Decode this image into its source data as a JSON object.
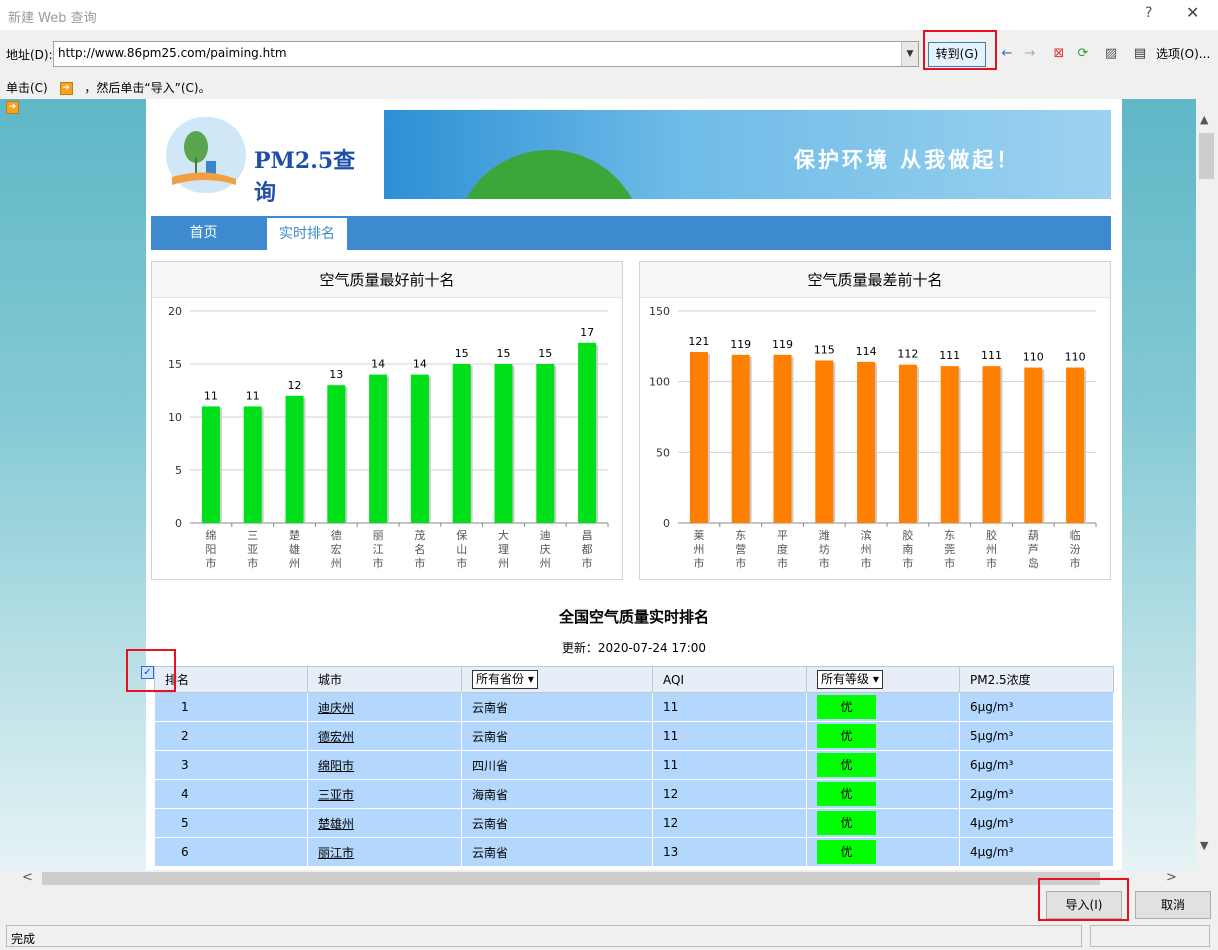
{
  "dialog": {
    "title": "新建 Web 查询",
    "help": "?",
    "close": "✕"
  },
  "address": {
    "label": "地址(D):",
    "url": "http://www.86pm25.com/paiming.htm",
    "go_label": "转到(G)",
    "options_label": "选项(O)..."
  },
  "instruction": {
    "prefix": "单击(C)",
    "suffix": "，然后单击“导入”(C)。"
  },
  "site": {
    "logo_text": "PM2.5查询",
    "banner_text": "保护环境 从我做起！",
    "nav": [
      "首页",
      "实时排名"
    ]
  },
  "best_chart": {
    "title": "空气质量最好前十名"
  },
  "worst_chart": {
    "title": "空气质量最差前十名"
  },
  "chart_data": [
    {
      "type": "bar",
      "title": "空气质量最好前十名",
      "categories": [
        "绵阳市",
        "三亚市",
        "楚雄州",
        "德宏州",
        "丽江市",
        "茂名市",
        "保山市",
        "大理州",
        "迪庆州",
        "昌都市"
      ],
      "values": [
        11,
        11,
        12,
        13,
        14,
        14,
        15,
        15,
        15,
        17
      ],
      "ylim": [
        0,
        20
      ],
      "yticks": [
        0,
        5,
        10,
        15,
        20
      ],
      "color": "#00e01a",
      "grid": true
    },
    {
      "type": "bar",
      "title": "空气质量最差前十名",
      "categories": [
        "莱州市",
        "东营市",
        "平度市",
        "潍坊市",
        "滨州市",
        "胶南市",
        "东莞市",
        "胶州市",
        "葫芦岛.",
        "临汾市"
      ],
      "values": [
        121,
        119,
        119,
        115,
        114,
        112,
        111,
        111,
        110,
        110
      ],
      "ylim": [
        0,
        150
      ],
      "yticks": [
        0,
        50,
        100,
        150
      ],
      "color": "#ff8000",
      "grid": true
    }
  ],
  "ranking": {
    "title": "全国空气质量实时排名",
    "updated": "更新：2020-07-24 17:00",
    "headers": {
      "rank": "排名",
      "city": "城市",
      "province_select": "所有省份",
      "aqi": "AQI",
      "grade_select": "所有等级",
      "pm25": "PM2.5浓度"
    },
    "rows": [
      {
        "rank": "1",
        "city": "迪庆州",
        "province": "云南省",
        "aqi": "11",
        "grade": "优",
        "pm25": "6μg/m³"
      },
      {
        "rank": "2",
        "city": "德宏州",
        "province": "云南省",
        "aqi": "11",
        "grade": "优",
        "pm25": "5μg/m³"
      },
      {
        "rank": "3",
        "city": "绵阳市",
        "province": "四川省",
        "aqi": "11",
        "grade": "优",
        "pm25": "6μg/m³"
      },
      {
        "rank": "4",
        "city": "三亚市",
        "province": "海南省",
        "aqi": "12",
        "grade": "优",
        "pm25": "2μg/m³"
      },
      {
        "rank": "5",
        "city": "楚雄州",
        "province": "云南省",
        "aqi": "12",
        "grade": "优",
        "pm25": "4μg/m³"
      },
      {
        "rank": "6",
        "city": "丽江市",
        "province": "云南省",
        "aqi": "13",
        "grade": "优",
        "pm25": "4μg/m³"
      }
    ]
  },
  "buttons": {
    "import": "导入(I)",
    "cancel": "取消"
  },
  "status": {
    "text": "完成"
  }
}
